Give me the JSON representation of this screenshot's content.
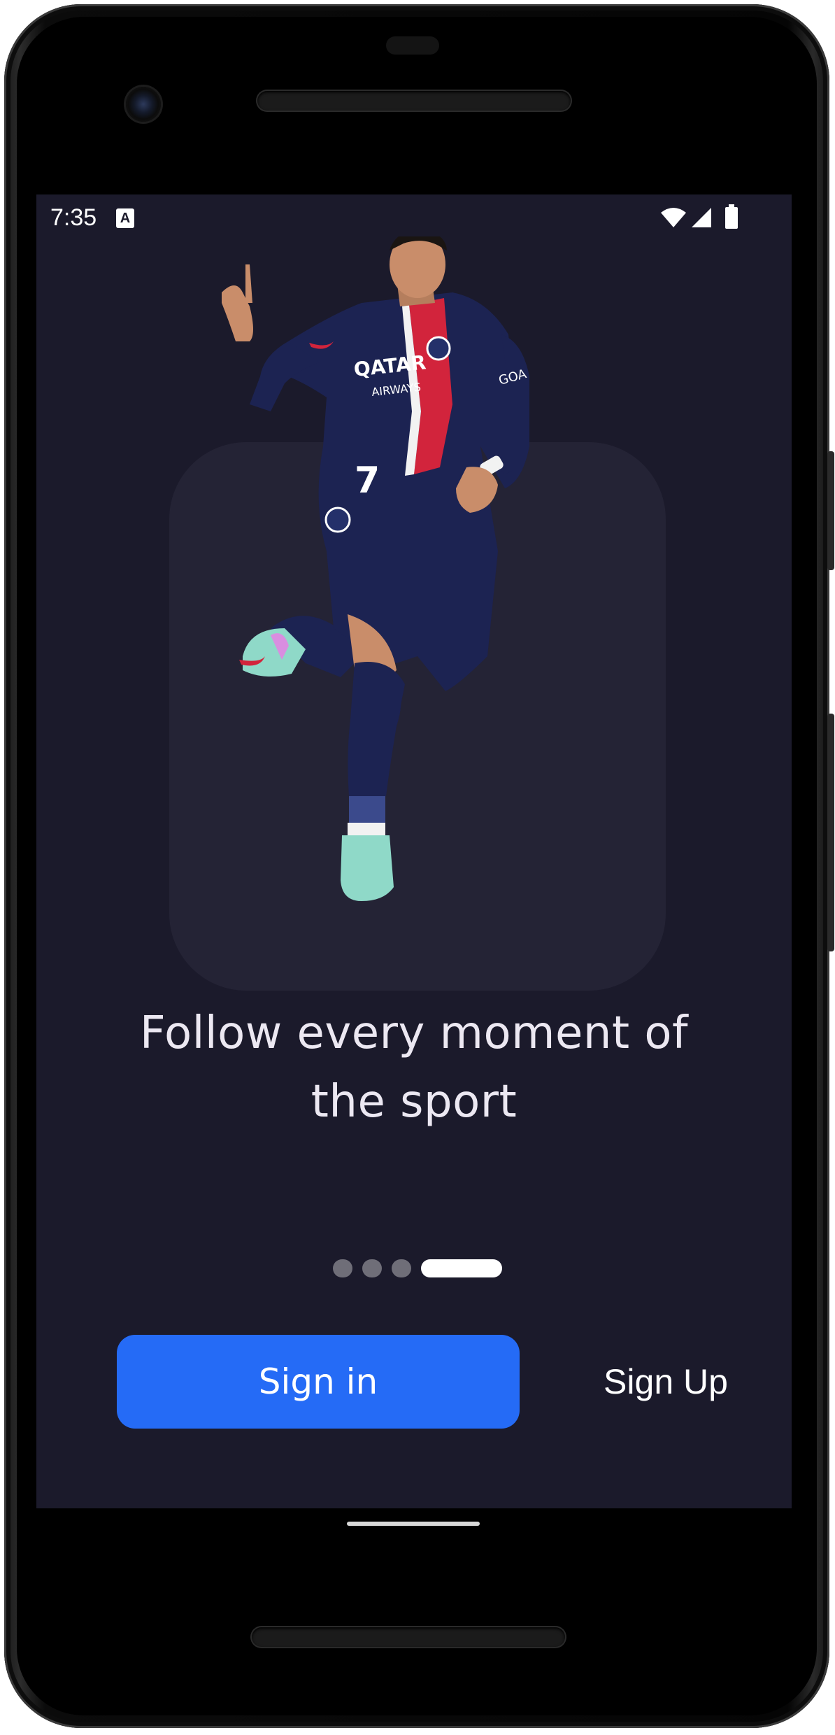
{
  "status_bar": {
    "time": "7:35",
    "notification_icon": "A",
    "icons": [
      "wifi-icon",
      "cell-signal-icon",
      "battery-icon"
    ]
  },
  "player_image": {
    "jersey_number": "7",
    "sponsor_line1": "QATAR",
    "sponsor_line2": "AIRWAYS",
    "sleeve_text": "GOA"
  },
  "onboarding": {
    "headline_line1": "Follow every moment of",
    "headline_line2": "the sport",
    "page_count": 4,
    "active_page": 4
  },
  "actions": {
    "sign_in_label": "Sign in",
    "sign_up_label": "Sign Up"
  },
  "colors": {
    "background": "#1b1a2b",
    "card": "#242335",
    "primary": "#256bf6",
    "text": "#ece8f2",
    "jersey_navy": "#1c2352",
    "jersey_red": "#d2243c"
  }
}
